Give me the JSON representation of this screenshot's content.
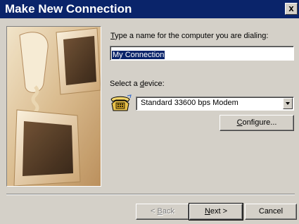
{
  "window": {
    "title": "Make New Connection",
    "close_label": "x"
  },
  "name_prompt": {
    "underline_letter": "T",
    "rest": "ype a name for the computer you are dialing:"
  },
  "name_field": {
    "value": "My Connection"
  },
  "device_prompt": {
    "prefix": "Select a ",
    "underline_letter": "d",
    "rest": "evice:"
  },
  "device_select": {
    "selected": "Standard 33600 bps Modem"
  },
  "configure_button": {
    "underline_letter": "C",
    "rest": "onfigure..."
  },
  "back_button": {
    "prefix": "< ",
    "underline_letter": "B",
    "rest": "ack"
  },
  "next_button": {
    "underline_letter": "N",
    "rest": "ext >"
  },
  "cancel_button": {
    "label": "Cancel"
  },
  "colors": {
    "titlebar": "#0a246a",
    "face": "#d4d0c8",
    "selection": "#0a246a"
  },
  "icons": {
    "device": "telephone-icon",
    "dropdown": "chevron-down-icon",
    "picture": "computer-illustration"
  }
}
